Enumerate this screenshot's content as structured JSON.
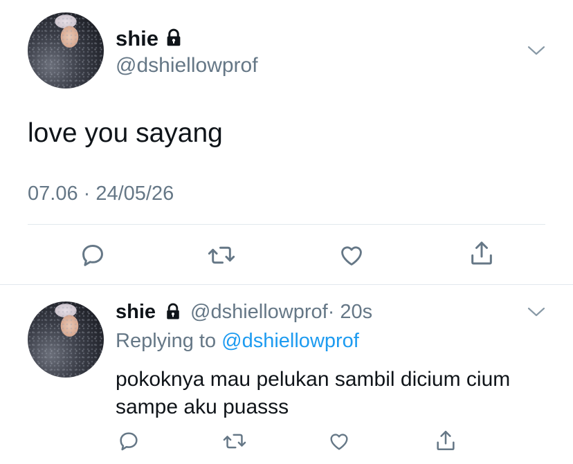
{
  "main_tweet": {
    "display_name": "shie",
    "handle": "@dshiellowprof",
    "text": "love you sayang",
    "timestamp": "07.06 · 24/05/26"
  },
  "reply": {
    "display_name": "shie",
    "handle": "@dshiellowprof",
    "time_ago": "· 20s",
    "replying_to_prefix": "Replying to",
    "replying_to_handle": "@dshiellowprof",
    "text_line1": "pokoknya mau pelukan sambil dicium cium",
    "text_line2": "sampe aku puasss"
  },
  "icons": {
    "lock": "lock-icon",
    "more": "chevron-down-icon",
    "reply": "reply-icon",
    "retweet": "retweet-icon",
    "like": "heart-icon",
    "share": "share-icon"
  },
  "colors": {
    "text": "#0f1419",
    "secondary": "#657786",
    "link": "#1d9bf0",
    "divider": "#e1e8ed"
  }
}
